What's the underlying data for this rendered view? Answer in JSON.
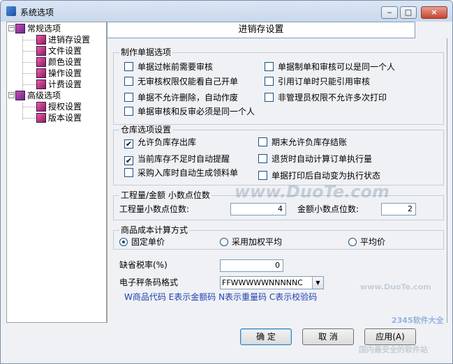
{
  "window": {
    "title": "系统选项",
    "min_label": "‒",
    "max_label": "□",
    "close_label": "×"
  },
  "tree": {
    "groups": [
      {
        "label": "常规选项",
        "expander": "−",
        "items": [
          "进销存设置",
          "文件设置",
          "颜色设置",
          "操作设置",
          "计费设置"
        ]
      },
      {
        "label": "高级选项",
        "expander": "−",
        "items": [
          "授权设置",
          "版本设置"
        ]
      }
    ]
  },
  "header": {
    "title": "进销存设置"
  },
  "doc_options": {
    "title": "制作单据选项",
    "items": [
      {
        "label": "单据过帐前需要审核",
        "checked": false
      },
      {
        "label": "单据制单和审核可以是同一个人",
        "checked": false
      },
      {
        "label": "无审核权限仅能看自己开单",
        "checked": false
      },
      {
        "label": "引用订单时只能引用审核",
        "checked": false
      },
      {
        "label": "单据不允许删除，自动作废",
        "checked": false
      },
      {
        "label": "非管理员权限不允许多次打印",
        "checked": false
      },
      {
        "label": "单据审核和反审必须是同一个人",
        "checked": false
      }
    ]
  },
  "warehouse": {
    "title": "仓库选项设置",
    "items": [
      {
        "label": "允许负库存出库",
        "checked": true
      },
      {
        "label": "期末允许负库存结账",
        "checked": false
      },
      {
        "label": "当前库存不足时自动提醒",
        "checked": true
      },
      {
        "label": "退货时自动计算订单执行量",
        "checked": false
      },
      {
        "label": "采购入库时自动生成领料单",
        "checked": false
      },
      {
        "label": "单据打印后自动变为执行状态",
        "checked": false
      }
    ]
  },
  "decimals": {
    "title": "工程量/金额 小数点位数",
    "qty_label": "工程量小数点位数:",
    "qty_value": "4",
    "amount_label": "金额小数点位数:",
    "amount_value": "2"
  },
  "cost": {
    "title": "商品成本计算方式",
    "options": [
      {
        "label": "固定单价",
        "selected": true
      },
      {
        "label": "采用加权平均",
        "selected": false
      },
      {
        "label": "平均价",
        "selected": false
      }
    ]
  },
  "tax": {
    "label": "缺省税率(%)",
    "value": "0"
  },
  "barcode": {
    "label": "电子秤条码格式",
    "value": "FFWWWWWNNNNNC",
    "hint": "W商品代码 E表示金额码 N表示重量码 C表示校验码"
  },
  "buttons": {
    "ok": "确 定",
    "cancel": "取 消",
    "apply": "应用(A)"
  },
  "watermarks": {
    "main": "www.DuoTe.com",
    "brand": "2345软件大全",
    "sub": "www.DuoTe.com",
    "footer": "国内最安全的软件站"
  }
}
